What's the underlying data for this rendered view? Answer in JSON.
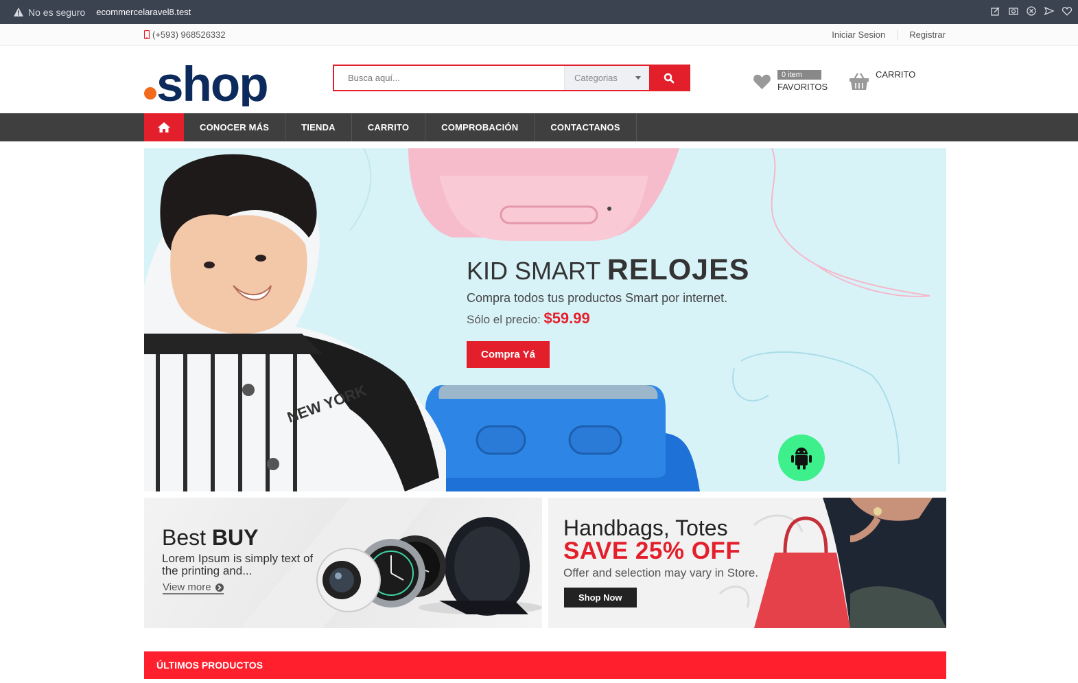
{
  "browser": {
    "security": "No es seguro",
    "url": "ecommercelaravel8.test"
  },
  "top_bar": {
    "phone": "(+593) 968526332",
    "login": "Iniciar Sesion",
    "register": "Registrar"
  },
  "header": {
    "logo": ".shop",
    "search_placeholder": "Busca aquí...",
    "category_select": "Categorias",
    "favorites_count": "0 item",
    "favorites_label": "FAVORITOS",
    "cart_label": "CARRITO"
  },
  "nav": {
    "items": [
      "CONOCER MÁS",
      "TIENDA",
      "CARRITO",
      "COMPROBACIÓN",
      "CONTACTANOS"
    ]
  },
  "hero": {
    "title_light": "KID SMART ",
    "title_bold": "RELOJES",
    "subtitle": "Compra todos tus productos Smart por internet.",
    "price_label": "Sólo el precio: ",
    "price": "$59.99",
    "button": "Compra Yá",
    "image_text": "NEW YORK"
  },
  "banner_left": {
    "title_light": "Best ",
    "title_bold": "BUY",
    "text": "Lorem Ipsum is simply text of the printing and...",
    "link": "View more"
  },
  "banner_right": {
    "title": "Handbags, Totes",
    "sale": "SAVE 25% OFF",
    "text": "Offer and selection may vary in Store.",
    "button": "Shop Now"
  },
  "latest": {
    "title": "ÚLTIMOS PRODUCTOS"
  },
  "colors": {
    "accent": "#e41f2c",
    "nav_bg": "#3f3f3f",
    "hero_bg": "#d8f3f8",
    "logo_dot": "#f26a1b",
    "logo_text": "#0c2a5b"
  }
}
